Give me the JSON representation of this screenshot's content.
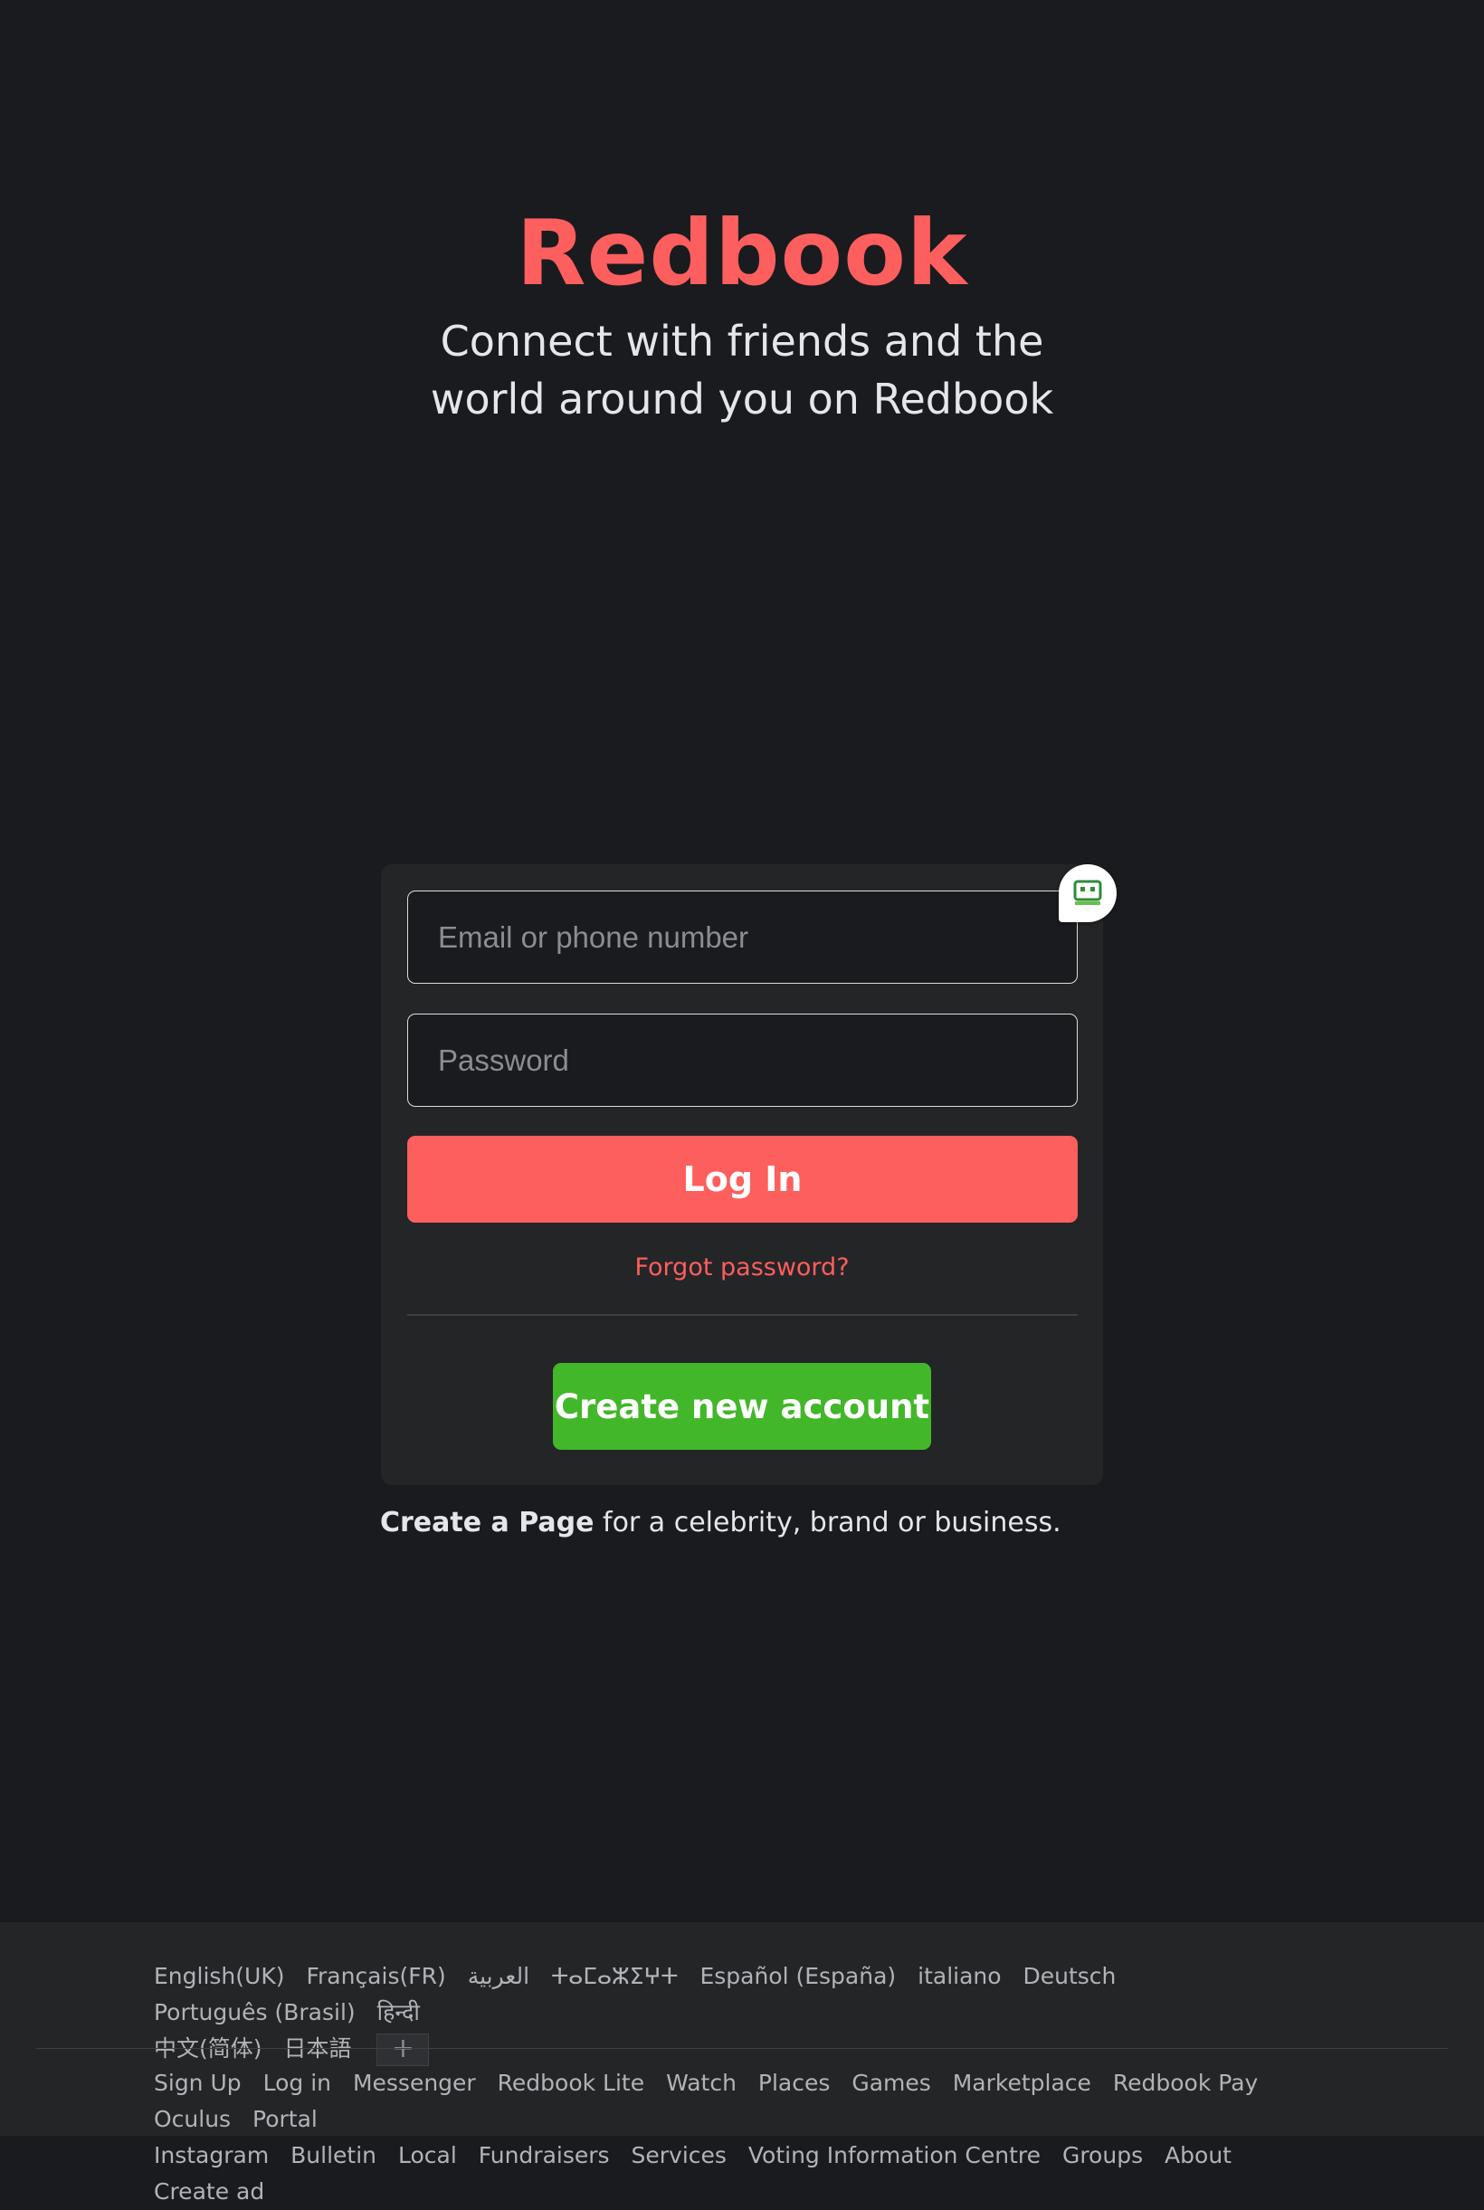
{
  "brand": {
    "name": "Redbook",
    "tagline": "Connect with friends and the world around you on Redbook"
  },
  "login": {
    "email_placeholder": "Email or phone number",
    "password_placeholder": "Password",
    "login_label": "Log In",
    "forgot_label": "Forgot password?",
    "create_label": "Create new account"
  },
  "create_page": {
    "link": "Create a Page",
    "rest": " for a celebrity, brand or business."
  },
  "footer": {
    "languages": [
      "English(UK)",
      "Français(FR)",
      "العربية",
      "ⵜⴰⵎⴰⵣⵉⵖⵜ",
      "Español (España)",
      "italiano",
      "Deutsch",
      "Português (Brasil)",
      "हिन्दी",
      "中文(简体)",
      "日本語"
    ],
    "add_language": "+",
    "links": [
      "Sign Up",
      "Log in",
      "Messenger",
      "Redbook Lite",
      "Watch",
      "Places",
      "Games",
      "Marketplace",
      "Redbook Pay",
      "Oculus",
      "Portal",
      "Instagram",
      "Bulletin",
      "Local",
      "Fundraisers",
      "Services",
      "Voting Information Centre",
      "Groups",
      "About",
      "Create ad"
    ]
  },
  "colors": {
    "brand": "#fd5e5e",
    "create": "#42b72a",
    "background": "#1a1b1e",
    "card": "#242527"
  },
  "icons": {
    "extension": "password-manager-icon"
  }
}
